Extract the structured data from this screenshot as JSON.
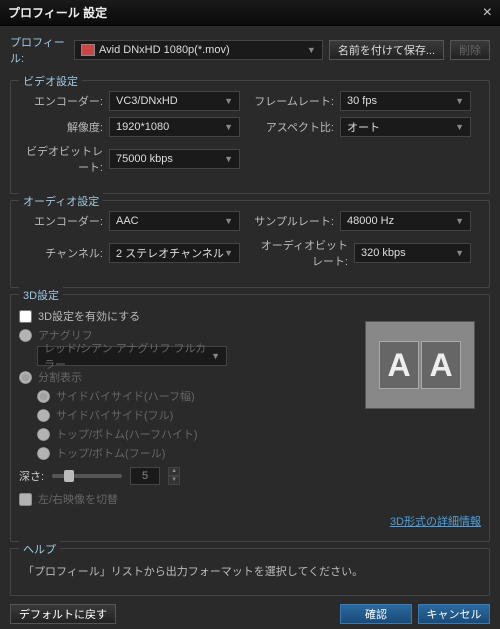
{
  "window": {
    "title": "プロフィール 設定"
  },
  "profile": {
    "label": "プロフィール:",
    "value": "Avid DNxHD 1080p(*.mov)",
    "save_as": "名前を付けて保存...",
    "delete": "削除"
  },
  "video": {
    "legend": "ビデオ設定",
    "encoder_label": "エンコーダー:",
    "encoder": "VC3/DNxHD",
    "resolution_label": "解像度:",
    "resolution": "1920*1080",
    "bitrate_label": "ビデオビットレート:",
    "bitrate": "75000 kbps",
    "framerate_label": "フレームレート:",
    "framerate": "30 fps",
    "aspect_label": "アスペクト比:",
    "aspect": "オート"
  },
  "audio": {
    "legend": "オーディオ設定",
    "encoder_label": "エンコーダー:",
    "encoder": "AAC",
    "channel_label": "チャンネル:",
    "channel": "2 ステレオチャンネル",
    "samplerate_label": "サンプルレート:",
    "samplerate": "48000 Hz",
    "bitrate_label": "オーディオビットレート:",
    "bitrate": "320 kbps"
  },
  "three_d": {
    "legend": "3D設定",
    "enable": "3D設定を有効にする",
    "anaglyph": "アナグリフ",
    "anaglyph_mode": "レッド/シアン アナグリフ フルカラー",
    "split": "分割表示",
    "sbs_half": "サイドバイサイド(ハーフ幅)",
    "sbs_full": "サイドバイサイド(フル)",
    "tb_half": "トップ/ボトム(ハーフハイト)",
    "tb_full": "トップ/ボトム(フール)",
    "depth_label": "深さ:",
    "depth_value": "5",
    "swap": "左/右映像を切替",
    "preview": "AA",
    "link": "3D形式の詳細情報"
  },
  "help": {
    "legend": "ヘルプ",
    "text": "「プロフィール」リストから出力フォーマットを選択してください。"
  },
  "footer": {
    "default": "デフォルトに戻す",
    "ok": "確認",
    "cancel": "キャンセル"
  }
}
